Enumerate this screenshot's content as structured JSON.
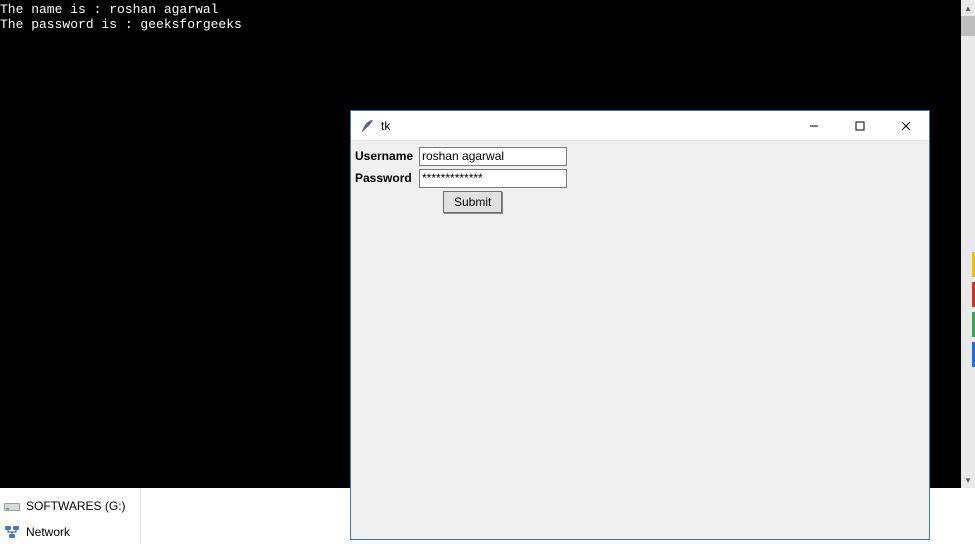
{
  "console": {
    "line1": "The name is : roshan agarwal",
    "line2": "The password is : geeksforgeeks"
  },
  "explorer": {
    "item1_label": "SOFTWARES (G:)",
    "item2_label": "Network"
  },
  "tk": {
    "title": "tk",
    "username_label": "Username",
    "password_label": "Password",
    "username_value": "roshan agarwal",
    "password_value": "*************",
    "submit_label": "Submit"
  },
  "edge_stubs": {
    "c1": "#f2c200",
    "c2": "#d93025",
    "c3": "#34a853",
    "c4": "#1a73e8"
  }
}
